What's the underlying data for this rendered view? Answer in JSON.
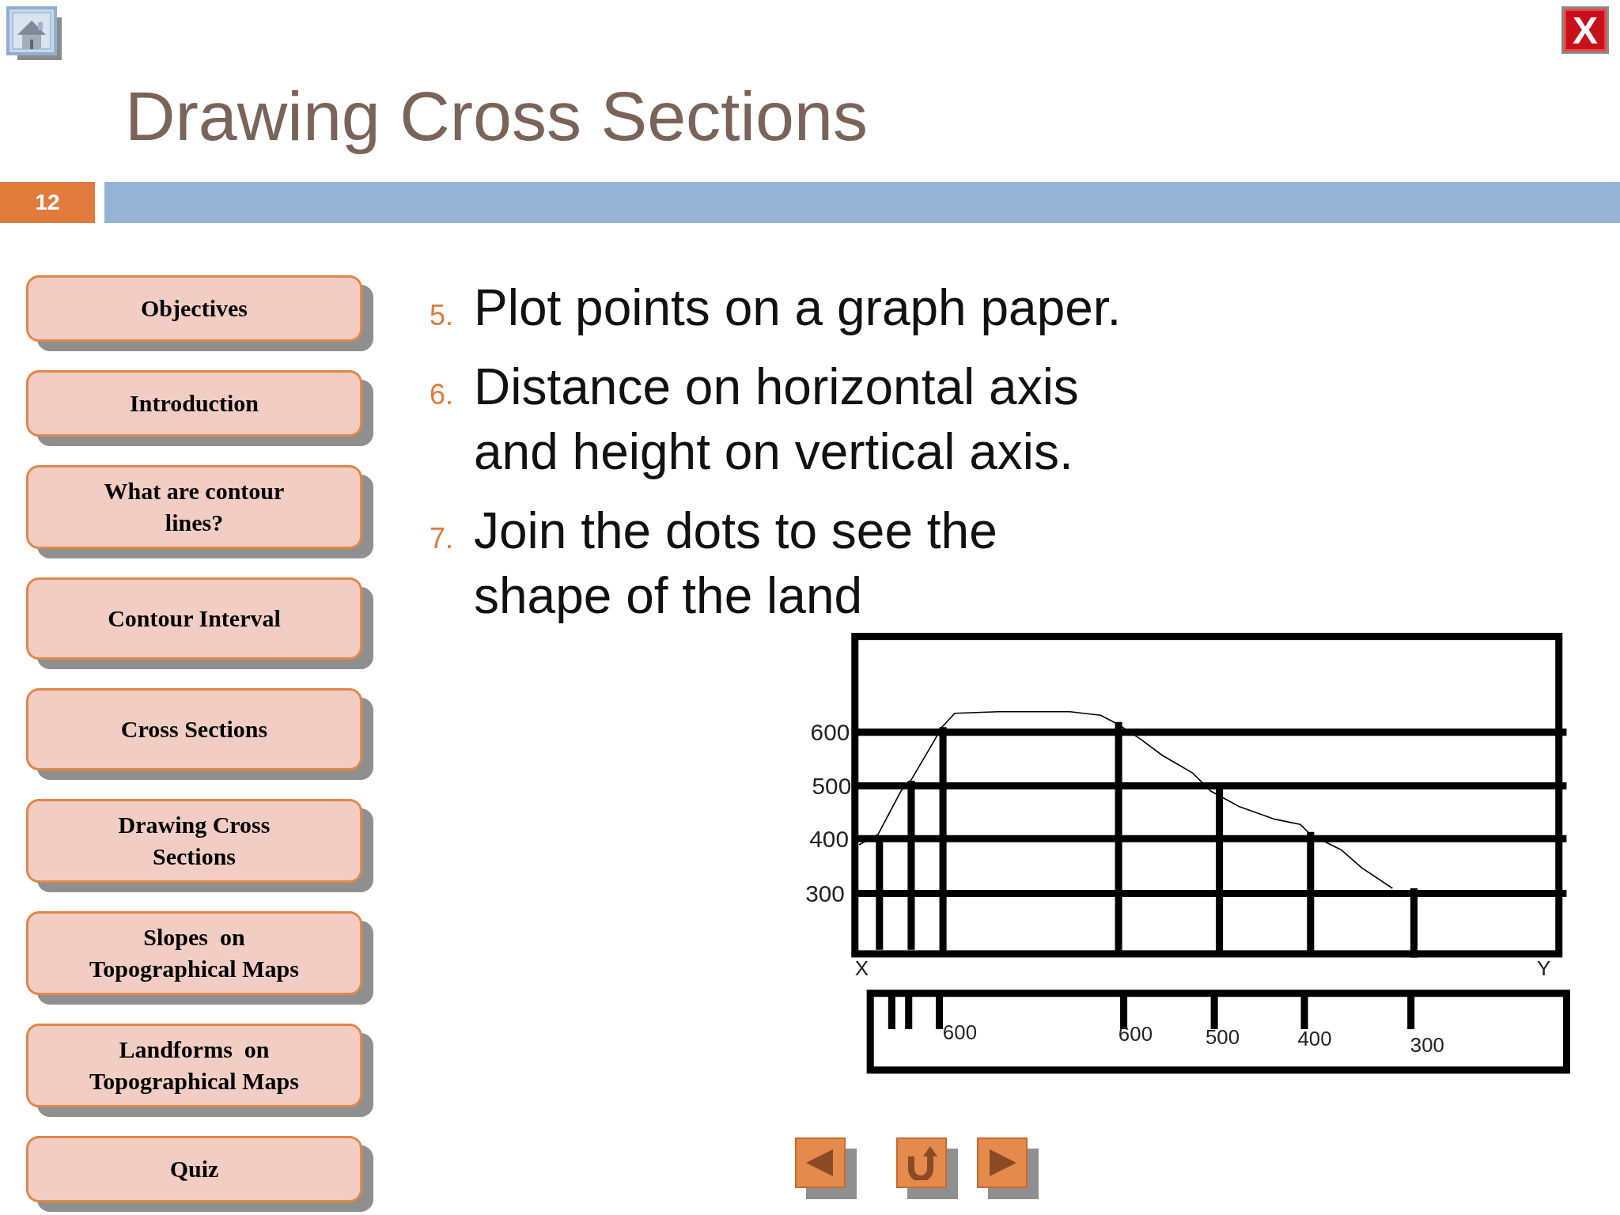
{
  "slide_number": "12",
  "close_label": "X",
  "title": "Drawing Cross Sections",
  "menu": [
    {
      "label": "Objectives"
    },
    {
      "label": "Introduction"
    },
    {
      "label": "What are contour lines?"
    },
    {
      "label": "Contour Interval"
    },
    {
      "label": "Cross Sections"
    },
    {
      "label": "Drawing Cross Sections"
    },
    {
      "label": "Slopes  on Topographical Maps"
    },
    {
      "label": "Landforms  on Topographical Maps"
    },
    {
      "label": "Quiz"
    }
  ],
  "steps": [
    {
      "number": "5.",
      "text": "Plot points on a graph paper."
    },
    {
      "number": "6.",
      "text": "Distance on horizontal axis and height on vertical axis."
    },
    {
      "number": "7.",
      "text": "Join the dots to see the shape of the land"
    }
  ],
  "diagram": {
    "height_labels": [
      "600",
      "500",
      "400",
      "300"
    ],
    "start_label": "X",
    "end_label": "Y",
    "strip_labels": [
      "600",
      "600",
      "500",
      "400",
      "300"
    ]
  }
}
